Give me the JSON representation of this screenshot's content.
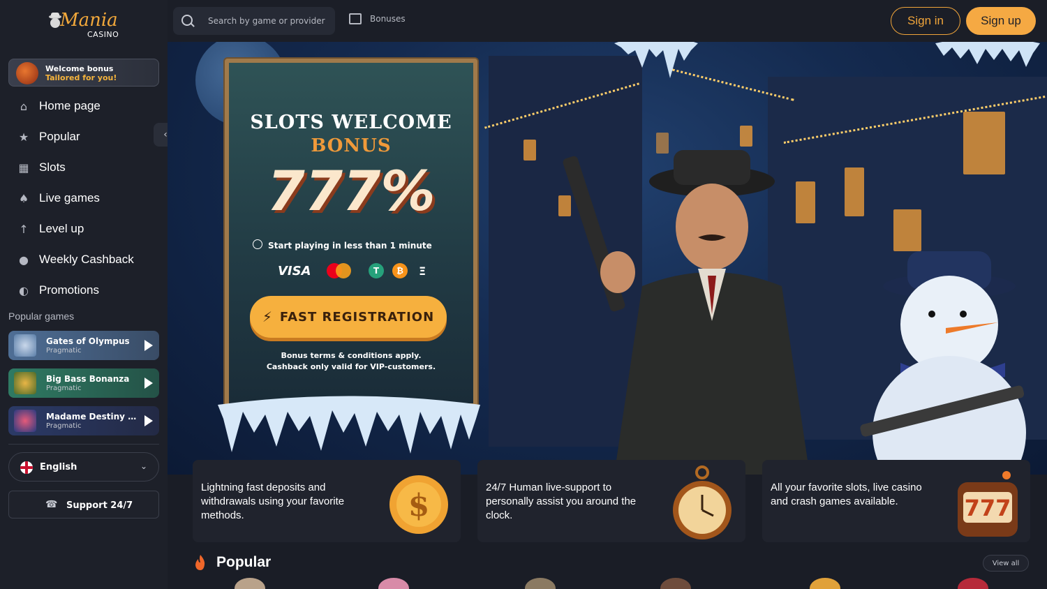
{
  "brand": {
    "name": "Mania",
    "sub": "CASINO"
  },
  "welcome": {
    "line1": "Welcome bonus",
    "line2": "Tailored for you!"
  },
  "nav": [
    {
      "label": "Home page",
      "icon": "home-icon"
    },
    {
      "label": "Popular",
      "icon": "star-icon"
    },
    {
      "label": "Slots",
      "icon": "slot-machine-icon"
    },
    {
      "label": "Live games",
      "icon": "live-dealer-icon"
    },
    {
      "label": "Level up",
      "icon": "level-up-icon"
    },
    {
      "label": "Weekly Cashback",
      "icon": "cashback-icon"
    },
    {
      "label": "Promotions",
      "icon": "promotions-icon"
    }
  ],
  "popular_games": {
    "title": "Popular games",
    "items": [
      {
        "name": "Gates of Olympus",
        "provider": "Pragmatic",
        "color": "#5a7ea8"
      },
      {
        "name": "Big Bass Bonanza",
        "provider": "Pragmatic",
        "color": "#2f7a63"
      },
      {
        "name": "Madame Destiny ...",
        "provider": "Pragmatic",
        "color": "#2b3a67"
      }
    ]
  },
  "language": {
    "label": "English"
  },
  "support": {
    "label": "Support 24/7"
  },
  "topbar": {
    "search_placeholder": "Search by game or provider",
    "bonuses": "Bonuses",
    "signin": "Sign in",
    "signup": "Sign up"
  },
  "hero": {
    "title": "SLOTS WELCOME",
    "subtitle": "BONUS",
    "percent": "777%",
    "start_text": "Start playing in less than 1 minute",
    "payments": [
      "VISA",
      "mastercard",
      "T",
      "₿",
      "Ξ"
    ],
    "cta": "FAST REGISTRATION",
    "terms1": "Bonus terms & conditions apply.",
    "terms2": "Cashback only valid for VIP-customers."
  },
  "features": [
    {
      "text": "Lightning fast deposits and withdrawals using your favorite methods.",
      "icon": "gold-coin-icon"
    },
    {
      "text": "24/7 Human live-support to personally assist you around the clock.",
      "icon": "pocket-watch-icon"
    },
    {
      "text": "All your favorite slots, live casino and crash games available.",
      "icon": "slot-777-icon"
    }
  ],
  "popular_section": {
    "title": "Popular",
    "view_all": "View all"
  },
  "colors": {
    "accent": "#f5a943",
    "sidebar": "#1d2029",
    "bg": "#1a1d26"
  }
}
